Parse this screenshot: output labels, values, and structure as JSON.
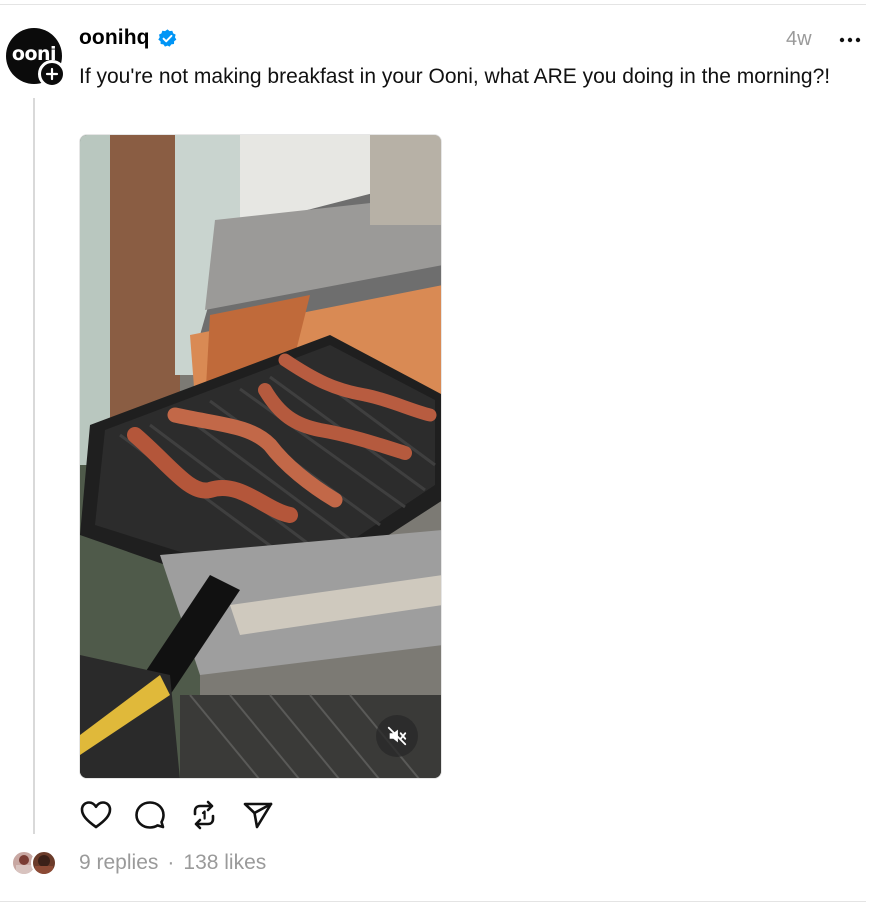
{
  "post": {
    "username": "oonihq",
    "verified": true,
    "avatar_text": "ooni",
    "time": "4w",
    "caption": "If you're not making breakfast in your Ooni, what ARE you doing in the morning?!",
    "media": {
      "muted": true
    },
    "replies": "9 replies",
    "separator": "·",
    "likes": "138 likes"
  },
  "icons": {
    "verified": "verified-badge-icon",
    "more": "more-options-icon",
    "follow": "plus-icon",
    "mute": "muted-speaker-icon",
    "like": "heart-icon",
    "reply": "comment-bubble-icon",
    "repost": "repost-icon",
    "share": "send-icon"
  },
  "colors": {
    "verified": "#0095f6",
    "muted_text": "#9a9a9a",
    "divider": "#e4e4e4"
  }
}
